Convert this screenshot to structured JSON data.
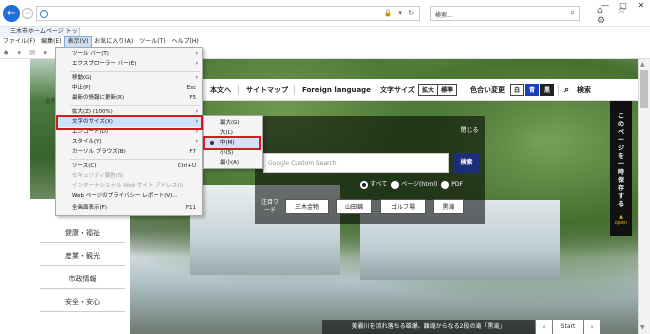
{
  "browser": {
    "address_url": "",
    "search_placeholder": "検索...",
    "tab_title": "三木市ホームページ トップページ",
    "back_glyph": "←",
    "forward_glyph": "→",
    "search_glyph": "⌕",
    "addr_tools": "🔒 ▾ ↻",
    "tool_icons": "⌂ ☆ ⚙",
    "window_controls": [
      "—",
      "□",
      "✕"
    ],
    "fav_icons": "♠ ▾ ✉ ▾",
    "menu": [
      {
        "label": "ファイル(F)"
      },
      {
        "label": "編集(E)"
      },
      {
        "label": "表示(V)",
        "active": true
      },
      {
        "label": "お気に入り(A)"
      },
      {
        "label": "ツール(T)"
      },
      {
        "label": "ヘルプ(H)"
      }
    ]
  },
  "view_menu": {
    "items": [
      {
        "label": "ツール バー(T)",
        "submenu": true
      },
      {
        "label": "エクスプローラー バー(E)",
        "submenu": true
      },
      {
        "label": "移動(G)",
        "submenu": true
      },
      {
        "label": "中止(P)",
        "shortcut": "Esc"
      },
      {
        "label": "最新の情報に更新(R)",
        "shortcut": "F5"
      },
      {
        "label": "拡大(Z) (100%)",
        "submenu": true
      },
      {
        "label": "文字のサイズ(X)",
        "submenu": true
      },
      {
        "label": "エンコード(D)",
        "submenu": true
      },
      {
        "label": "スタイル(Y)",
        "submenu": true
      },
      {
        "label": "カーソル ブラウズ(B)",
        "shortcut": "F7"
      },
      {
        "label": "ソース(C)",
        "shortcut": "Ctrl+U"
      },
      {
        "label": "セキュリティ報告(S)",
        "disabled": true
      },
      {
        "label": "インターナショナル Web サイト アドレス(I)",
        "disabled": true
      },
      {
        "label": "Web ページのプライバシー レポート(V)..."
      },
      {
        "label": "全画面表示(F)",
        "shortcut": "F11"
      }
    ]
  },
  "text_size_menu": {
    "items": [
      {
        "label": "最大(G)"
      },
      {
        "label": "大(L)"
      },
      {
        "label": "中(M)",
        "selected": true
      },
      {
        "label": "小(S)"
      },
      {
        "label": "最小(A)"
      }
    ]
  },
  "site": {
    "header": {
      "nav": [
        "本文へ",
        "サイトマップ",
        "Foreign language"
      ],
      "text_size_label": "文字サイズ",
      "enlarge": "拡大",
      "standard": "標準",
      "color_label": "色合い変更",
      "color_white": "白",
      "color_blue": "青",
      "color_black": "黒",
      "search_label": "検索"
    },
    "sidenav": [
      "健康・福祉",
      "産業・観光",
      "市政情報",
      "安全・安心"
    ],
    "side_top_fragment": "全般",
    "search_panel": {
      "close": "閉じる",
      "google_prefix": "Google",
      "placeholder": "Custom Search",
      "button": "検索",
      "scopes": [
        {
          "label": "すべて",
          "checked": true
        },
        {
          "label": "ページ(html)",
          "checked": false
        },
        {
          "label": "PDF",
          "checked": false
        }
      ],
      "attention_label": "注目ワード",
      "keywords": [
        "三木金物",
        "山田錦",
        "ゴルフ場",
        "黒滝"
      ]
    },
    "side_banner": {
      "text": "このページを一時保存する",
      "open": "▲ open"
    },
    "caption": "美嚢川を流れ落ちる雄瀬、離滝からなる2段の滝「黒滝」",
    "slider": {
      "prev": "‹",
      "start": "Start",
      "next": "›"
    }
  },
  "colors": {
    "menu_highlight": "#cde3f9",
    "red_box": "#d31d1d",
    "search_button": "#1c2e7a",
    "blue_theme": "#1a3fbf",
    "open_accent": "#e9b200"
  }
}
